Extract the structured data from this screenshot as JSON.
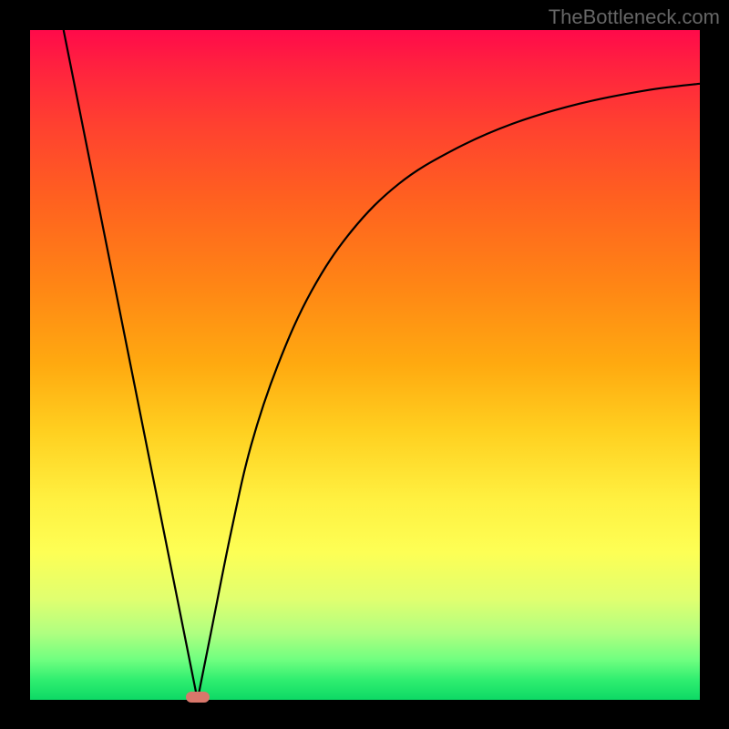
{
  "watermark": "TheBottleneck.com",
  "chart_data": {
    "type": "line",
    "title": "",
    "xlabel": "",
    "ylabel": "",
    "xlim": [
      0,
      1
    ],
    "ylim": [
      0,
      1
    ],
    "minimum_point": {
      "x": 0.25,
      "y": 0.0
    },
    "series": [
      {
        "name": "left-branch",
        "x": [
          0.05,
          0.1,
          0.15,
          0.2,
          0.24,
          0.25
        ],
        "y": [
          1.0,
          0.75,
          0.5,
          0.25,
          0.05,
          0.0
        ]
      },
      {
        "name": "right-branch",
        "x": [
          0.25,
          0.27,
          0.3,
          0.33,
          0.37,
          0.42,
          0.48,
          0.55,
          0.63,
          0.72,
          0.82,
          0.92,
          1.0
        ],
        "y": [
          0.0,
          0.1,
          0.25,
          0.38,
          0.5,
          0.61,
          0.7,
          0.77,
          0.82,
          0.86,
          0.89,
          0.91,
          0.92
        ]
      }
    ],
    "gradient_colors": {
      "top": "#ff0a4a",
      "mid": "#ffd500",
      "bottom": "#14d96a"
    },
    "marker": {
      "color": "#d9776b",
      "x": 0.25,
      "y": 0.0,
      "width_frac": 0.035,
      "height_frac": 0.017
    }
  }
}
